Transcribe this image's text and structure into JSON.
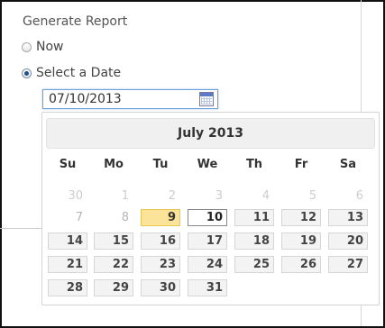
{
  "form": {
    "title": "Generate Report",
    "options": [
      {
        "label": "Now",
        "checked": false
      },
      {
        "label": "Select a Date",
        "checked": true
      }
    ],
    "date_value": "07/10/2013",
    "calendar_icon": "calendar-icon"
  },
  "datepicker": {
    "month_label": "July 2013",
    "weekdays": [
      "Su",
      "Mo",
      "Tu",
      "We",
      "Th",
      "Fr",
      "Sa"
    ],
    "weeks": [
      [
        {
          "d": "30",
          "s": "other"
        },
        {
          "d": "1",
          "s": "other"
        },
        {
          "d": "2",
          "s": "other"
        },
        {
          "d": "3",
          "s": "other"
        },
        {
          "d": "4",
          "s": "other"
        },
        {
          "d": "5",
          "s": "other"
        },
        {
          "d": "6",
          "s": "other"
        }
      ],
      [
        {
          "d": "7",
          "s": "past"
        },
        {
          "d": "8",
          "s": "past"
        },
        {
          "d": "9",
          "s": "today"
        },
        {
          "d": "10",
          "s": "selected"
        },
        {
          "d": "11",
          "s": "enabled"
        },
        {
          "d": "12",
          "s": "enabled"
        },
        {
          "d": "13",
          "s": "enabled"
        }
      ],
      [
        {
          "d": "14",
          "s": "enabled"
        },
        {
          "d": "15",
          "s": "enabled"
        },
        {
          "d": "16",
          "s": "enabled"
        },
        {
          "d": "17",
          "s": "enabled"
        },
        {
          "d": "18",
          "s": "enabled"
        },
        {
          "d": "19",
          "s": "enabled"
        },
        {
          "d": "20",
          "s": "enabled"
        }
      ],
      [
        {
          "d": "21",
          "s": "enabled"
        },
        {
          "d": "22",
          "s": "enabled"
        },
        {
          "d": "23",
          "s": "enabled"
        },
        {
          "d": "24",
          "s": "enabled"
        },
        {
          "d": "25",
          "s": "enabled"
        },
        {
          "d": "26",
          "s": "enabled"
        },
        {
          "d": "27",
          "s": "enabled"
        }
      ],
      [
        {
          "d": "28",
          "s": "enabled"
        },
        {
          "d": "29",
          "s": "enabled"
        },
        {
          "d": "30",
          "s": "enabled"
        },
        {
          "d": "31",
          "s": "enabled"
        }
      ]
    ]
  },
  "colors": {
    "today_highlight": "#fbe49a",
    "selected_radio": "#1f4f8e",
    "input_focus": "#6e9fd8"
  }
}
